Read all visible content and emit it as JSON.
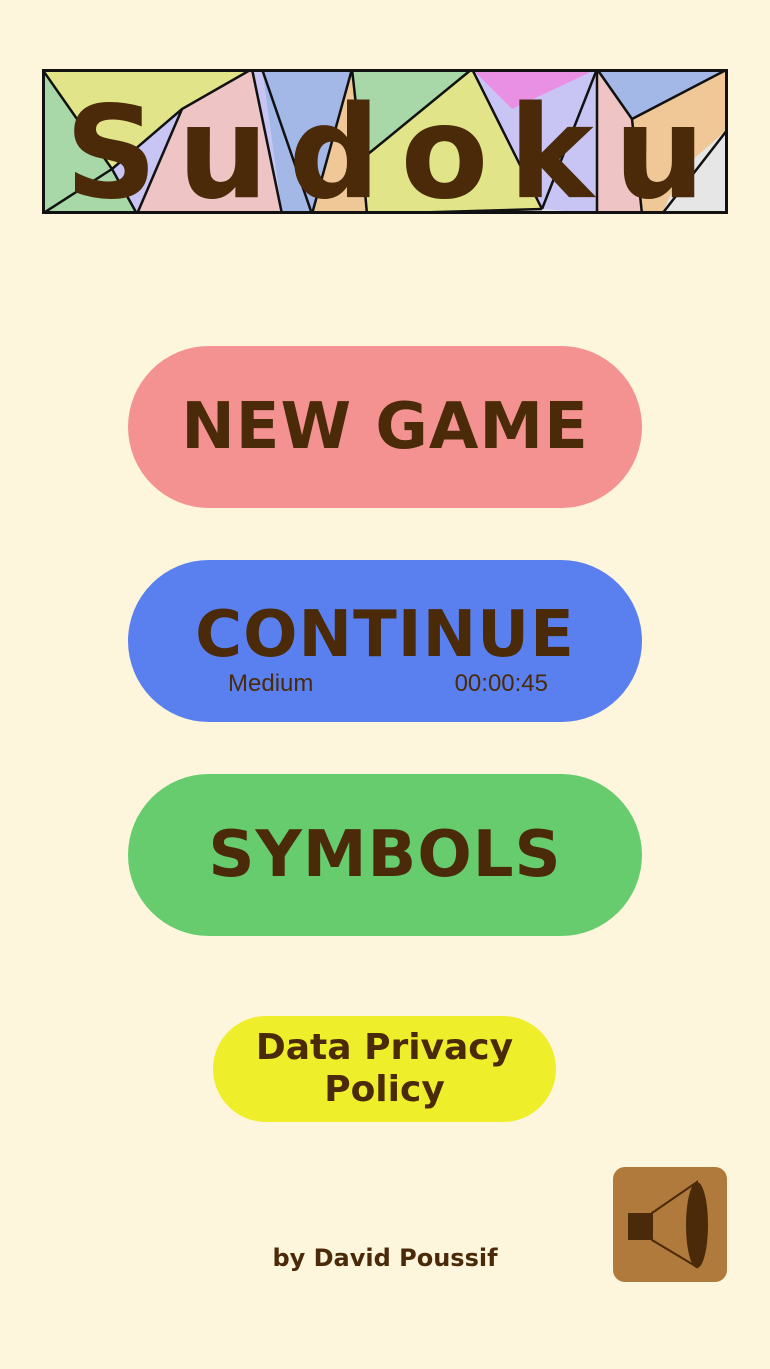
{
  "app": {
    "title": "Sudoku"
  },
  "menu": {
    "new_game": "NEW GAME",
    "continue": {
      "label": "CONTINUE",
      "difficulty": "Medium",
      "elapsed_time": "00:00:45"
    },
    "symbols": "SYMBOLS",
    "privacy_line1": "Data Privacy",
    "privacy_line2": "Policy"
  },
  "footer": {
    "author": "by David Poussif"
  },
  "sound": {
    "icon": "speaker-icon"
  },
  "colors": {
    "background": "#fef6dc",
    "text": "#4a2a08",
    "new_game_button": "#f39290",
    "continue_button": "#5a80f0",
    "symbols_button": "#66cc6e",
    "privacy_button": "#eeee2a",
    "sound_button": "#b07a3c"
  }
}
